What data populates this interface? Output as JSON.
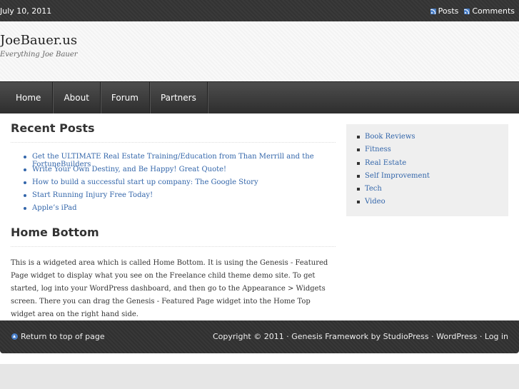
{
  "topbar": {
    "date": "July 10, 2011",
    "feeds": [
      {
        "label": "Posts",
        "icon": "rss-icon"
      },
      {
        "label": "Comments",
        "icon": "rss-icon"
      }
    ]
  },
  "header": {
    "title": "JoeBauer.us",
    "description": "Everything Joe Bauer"
  },
  "nav": {
    "items": [
      "Home",
      "About",
      "Forum",
      "Partners"
    ]
  },
  "recent_posts": {
    "title": "Recent Posts",
    "items": [
      "Get the ULTIMATE Real Estate Training/Education from Than Merrill and the FortuneBuilders",
      "Write Your Own Destiny, and Be Happy! Great Quote!",
      "How to build a successful start up company: The Google Story",
      "Start Running Injury Free Today!",
      "Apple’s iPad"
    ]
  },
  "home_bottom": {
    "title": "Home Bottom",
    "text": "This is a widgeted area which is called Home Bottom. It is using the Genesis - Featured Page widget to display what you see on the Freelance child theme demo site. To get started, log into your WordPress dashboard, and then go to the Appearance > Widgets screen. There you can drag the Genesis - Featured Page widget into the Home Top widget area on the right hand side."
  },
  "sidebar": {
    "categories": [
      "Book Reviews",
      "Fitness",
      "Real Estate",
      "Self Improvement",
      "Tech",
      "Video"
    ]
  },
  "footer": {
    "back_to_top": "Return to top of page",
    "copyright": "Copyright © 2011 · Genesis Framework by StudioPress · WordPress · Log in"
  },
  "colors": {
    "link": "#3366aa",
    "nav_bg": "#3a3a3a",
    "sidebar_bg": "#efefef"
  }
}
